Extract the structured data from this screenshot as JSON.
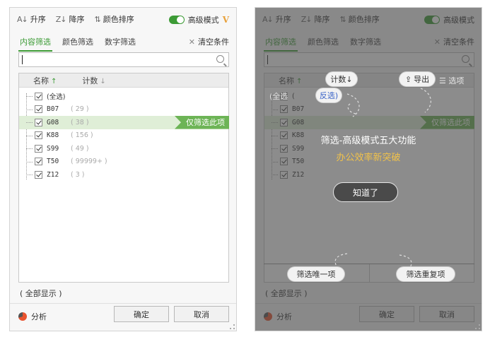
{
  "toolbar": {
    "sort_asc": "升序",
    "sort_desc": "降序",
    "color_sort": "颜色排序",
    "advanced_mode": "高级模式",
    "vip": "V"
  },
  "tabs": [
    "内容筛选",
    "颜色筛选",
    "数字筛选"
  ],
  "clear_label": "清空条件",
  "columns": {
    "name": "名称",
    "count": "计数"
  },
  "rows": [
    {
      "name": "(全选)",
      "count": ""
    },
    {
      "name": "B07",
      "count": "( 29 )"
    },
    {
      "name": "G08",
      "count": "( 38 )"
    },
    {
      "name": "K88",
      "count": "( 156 )"
    },
    {
      "name": "S99",
      "count": "( 49 )"
    },
    {
      "name": "T50",
      "count": "( 99999+ )"
    },
    {
      "name": "Z12",
      "count": "( 3 )"
    }
  ],
  "filter_only_tag": "仅筛选此项",
  "show_all": "( 全部显示 )",
  "analyze": "分析",
  "ok": "确定",
  "cancel": "取消",
  "guide": {
    "select_all": "全选",
    "invert": "反选",
    "count": "计数↓",
    "export": "导出",
    "options": "选项",
    "title": "筛选-高级模式五大功能",
    "subtitle": "办公效率新突破",
    "got_it": "知道了",
    "unique": "筛选唯一项",
    "duplicate": "筛选重复项"
  },
  "colors": {
    "accent": "#3d9b36",
    "tag": "#6db456",
    "vip": "#e8a13a",
    "guide_highlight": "#f1c24a"
  }
}
